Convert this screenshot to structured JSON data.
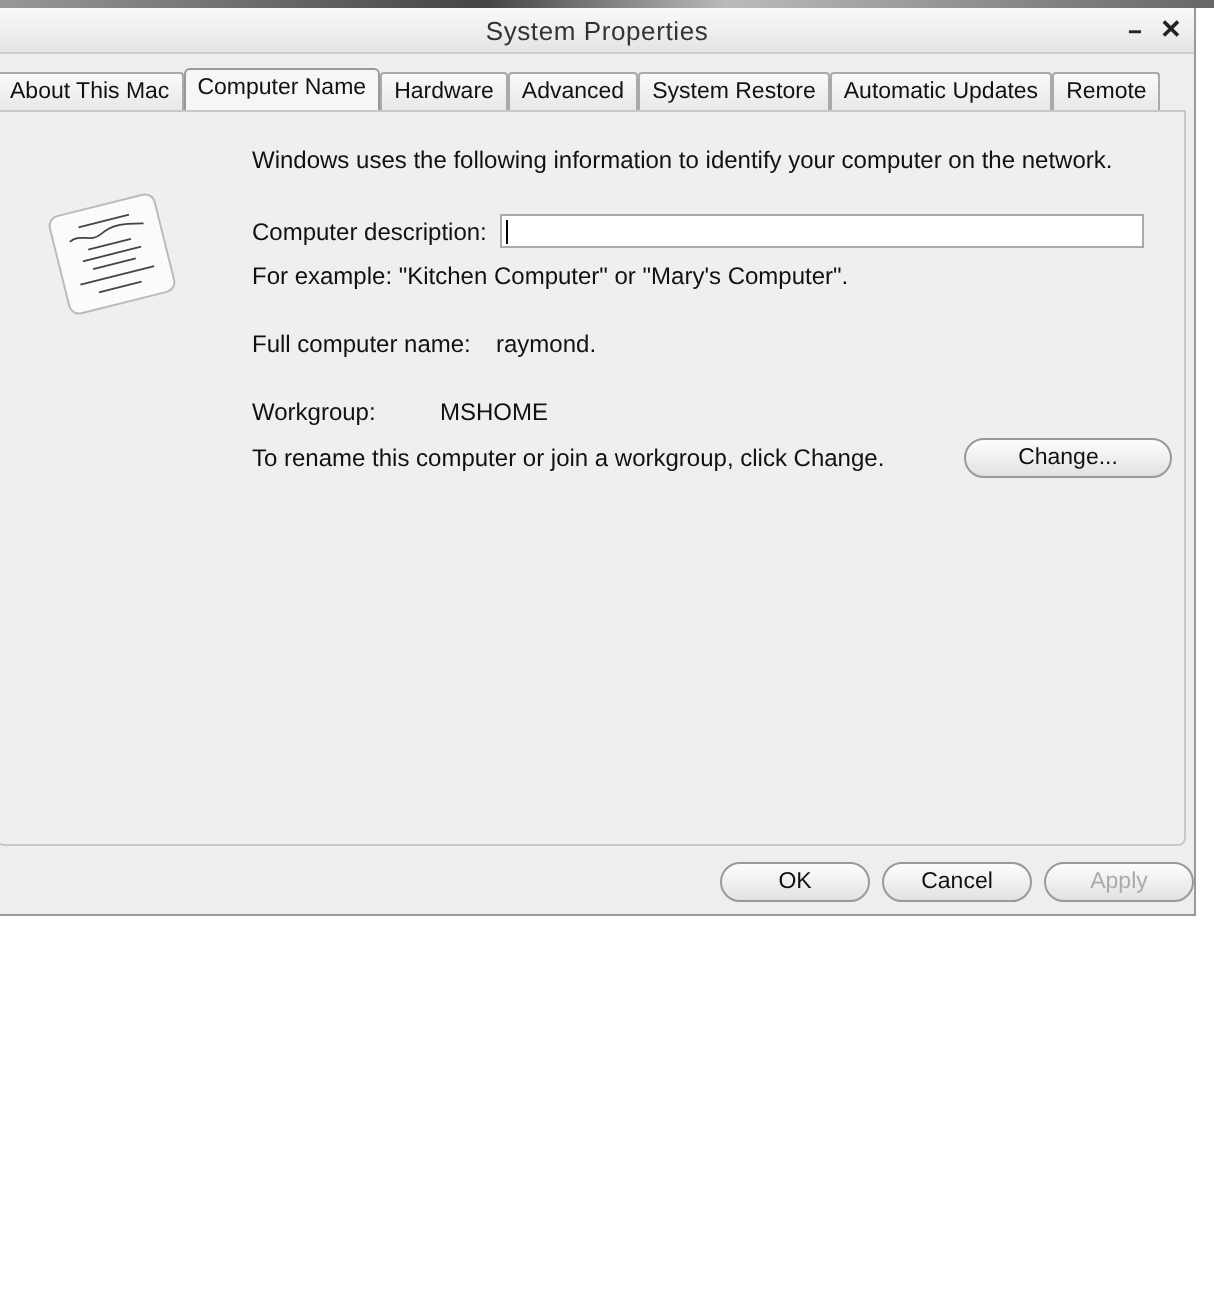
{
  "window": {
    "title": "System Properties",
    "controls": [
      {
        "kind": "minimize",
        "label": "--"
      },
      {
        "kind": "close",
        "label": "✕"
      }
    ]
  },
  "tabs": [
    {
      "label": "About This Mac",
      "selected": false
    },
    {
      "label": "Computer Name",
      "selected": true
    },
    {
      "label": "Hardware",
      "selected": false
    },
    {
      "label": "Advanced",
      "selected": false
    },
    {
      "label": "System Restore",
      "selected": false
    },
    {
      "label": "Automatic Updates",
      "selected": false
    },
    {
      "label": "Remote",
      "selected": false
    }
  ],
  "intro": "Windows uses the following information to identify your computer on the network.",
  "description": {
    "label": "Computer description:",
    "focused": true
  },
  "example": "For example: \"Kitchen Computer\" or \"Mary's Computer\".",
  "full_name": {
    "label": "Full computer name:",
    "value": "raymond."
  },
  "workgroup": {
    "label": "Workgroup:",
    "value": "MSHOME"
  },
  "rename_text": "To rename this computer or join a workgroup, click Change.",
  "change_button": {
    "label": "Change...",
    "disabled": false
  },
  "buttons": [
    {
      "label": "OK",
      "disabled": false
    },
    {
      "label": "Cancel",
      "disabled": false
    },
    {
      "label": "Apply",
      "disabled": true
    }
  ]
}
